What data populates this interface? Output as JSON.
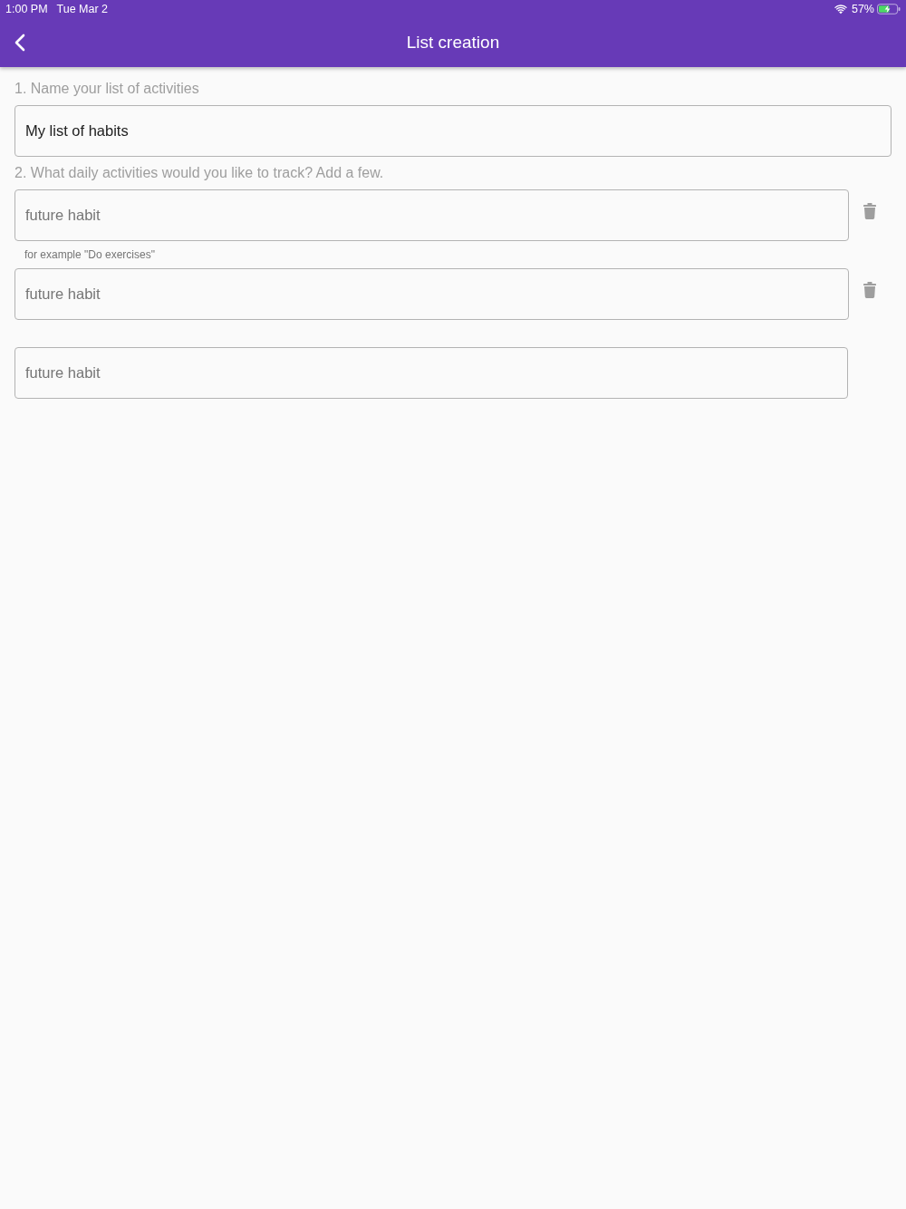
{
  "status_bar": {
    "time": "1:00 PM",
    "date": "Tue Mar 2",
    "battery": "57%"
  },
  "app_bar": {
    "title": "List creation"
  },
  "name_section": {
    "label": "1. Name your list of activities",
    "field": {
      "value": "My list of habits"
    }
  },
  "habits_section": {
    "label": "2. What daily activities would you like to track? Add a few.",
    "fields": [
      {
        "placeholder": "future habit",
        "helper": "for example \"Do exercises\"",
        "deletable": true
      },
      {
        "placeholder": "future habit",
        "deletable": true
      },
      {
        "placeholder": "future habit",
        "deletable": false
      }
    ]
  }
}
